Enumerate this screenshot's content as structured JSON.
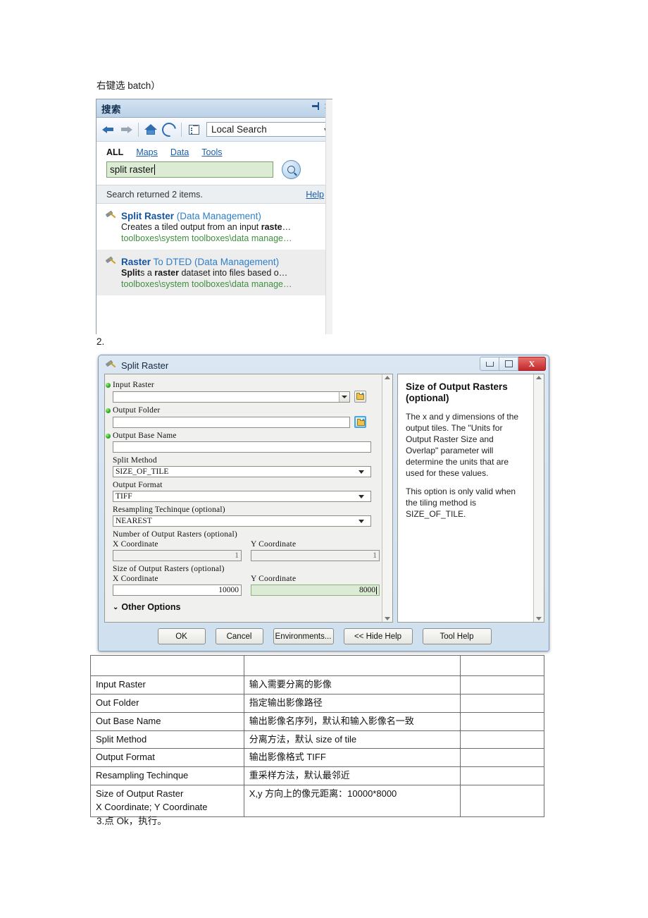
{
  "doc": {
    "caption_top": "右键选 batch）",
    "step_2": "2.",
    "step_3": "3.点 Ok，执行。"
  },
  "search_panel": {
    "title": "搜索",
    "pin_icon": "pin-icon",
    "close_icon": "close-icon",
    "toolbar": {
      "back_icon": "back-arrow-icon",
      "forward_icon": "forward-arrow-icon",
      "home_icon": "home-icon",
      "refresh_icon": "refresh-icon",
      "list_icon": "list-view-icon",
      "scope_value": "Local Search",
      "scope_caret": "▾"
    },
    "tabs": [
      {
        "label": "ALL",
        "active": true
      },
      {
        "label": "Maps",
        "active": false
      },
      {
        "label": "Data",
        "active": false
      },
      {
        "label": "Tools",
        "active": false
      }
    ],
    "query": "split raster",
    "search_button_icon": "magnifier-icon",
    "status": "Search returned 2 items.",
    "help_link": "Help",
    "results": [
      {
        "icon": "hammer-tool-icon",
        "title_bold": "Split Raster",
        "title_rest": " (Data Management)",
        "desc_html": "Creates a tiled output from an input <b>raste</b>…",
        "path": "toolboxes\\system toolboxes\\data manage…"
      },
      {
        "icon": "hammer-tool-icon",
        "title_bold": "Raster",
        "title_rest": " To DTED (Data Management)",
        "desc_html": "<b>Split</b>s a <b>raster</b> dataset into files based o…",
        "path": "toolboxes\\system toolboxes\\data manage…"
      }
    ]
  },
  "dialog": {
    "title": "Split Raster",
    "tool_icon": "hammer-tool-icon",
    "window_buttons": {
      "minimize": "minimize-icon",
      "maximize": "maximize-icon",
      "close": "X"
    },
    "params": [
      {
        "label": "Input Raster",
        "required": true,
        "type": "combo-browse",
        "value": ""
      },
      {
        "label": "Output Folder",
        "required": true,
        "type": "text-browse",
        "value": "",
        "focused": true
      },
      {
        "label": "Output Base Name",
        "required": true,
        "type": "text",
        "value": ""
      },
      {
        "label": "Split Method",
        "required": false,
        "type": "combo",
        "value": "SIZE_OF_TILE"
      },
      {
        "label": "Output Format",
        "required": false,
        "type": "combo",
        "value": "TIFF"
      },
      {
        "label": "Resampling Techinque (optional)",
        "required": false,
        "type": "combo",
        "value": "NEAREST"
      }
    ],
    "group_number": {
      "label": "Number of Output Rasters (optional)",
      "x_label": "X Coordinate",
      "y_label": "Y Coordinate",
      "x_value": "1",
      "y_value": "1",
      "readonly": true
    },
    "group_size": {
      "label": "Size of Output Rasters (optional)",
      "x_label": "X Coordinate",
      "y_label": "Y Coordinate",
      "x_value": "10000",
      "y_value": "8000",
      "y_focused": true
    },
    "other_options": "Other Options",
    "help": {
      "title": "Size of Output Rasters (optional)",
      "paragraphs": [
        "The x and y dimensions of the output tiles. The \"Units for Output Raster Size and Overlap\" parameter will determine the units that are used for these values.",
        "This option is only valid when the tiling method is SIZE_OF_TILE."
      ]
    },
    "buttons": [
      {
        "label": "OK",
        "width": "w1"
      },
      {
        "label": "Cancel",
        "width": "w1"
      },
      {
        "label": "Environments...",
        "width": "w2"
      },
      {
        "label": "<< Hide Help",
        "width": "w3"
      },
      {
        "label": "Tool Help",
        "width": "w3"
      }
    ]
  },
  "table": {
    "rows": [
      {
        "c1": "",
        "c2": "",
        "c3": ""
      },
      {
        "c1": "Input Raster",
        "c2": "输入需要分离的影像",
        "c3": ""
      },
      {
        "c1": "Out Folder",
        "c2": "指定输出影像路径",
        "c3": ""
      },
      {
        "c1": "Out Base Name",
        "c2": "输出影像名序列，默认和输入影像名一致",
        "c3": ""
      },
      {
        "c1": "Split Method",
        "c2": "分离方法，默认 size of tile",
        "c3": ""
      },
      {
        "c1": "Output Format",
        "c2": "输出影像格式 TIFF",
        "c3": ""
      },
      {
        "c1": "Resampling Techinque",
        "c2": "重采样方法，默认最邻近",
        "c3": ""
      },
      {
        "c1": "Size of Output Raster\nX Coordinate; Y Coordinate",
        "c2": "X,y 方向上的像元距离：10000*8000",
        "c3": ""
      }
    ]
  },
  "colors": {
    "accent_blue": "#1554a0",
    "path_green": "#3f8f3f",
    "field_green": "#dcecd4",
    "title_blue": "#13304e",
    "close_red": "#c1272d"
  }
}
